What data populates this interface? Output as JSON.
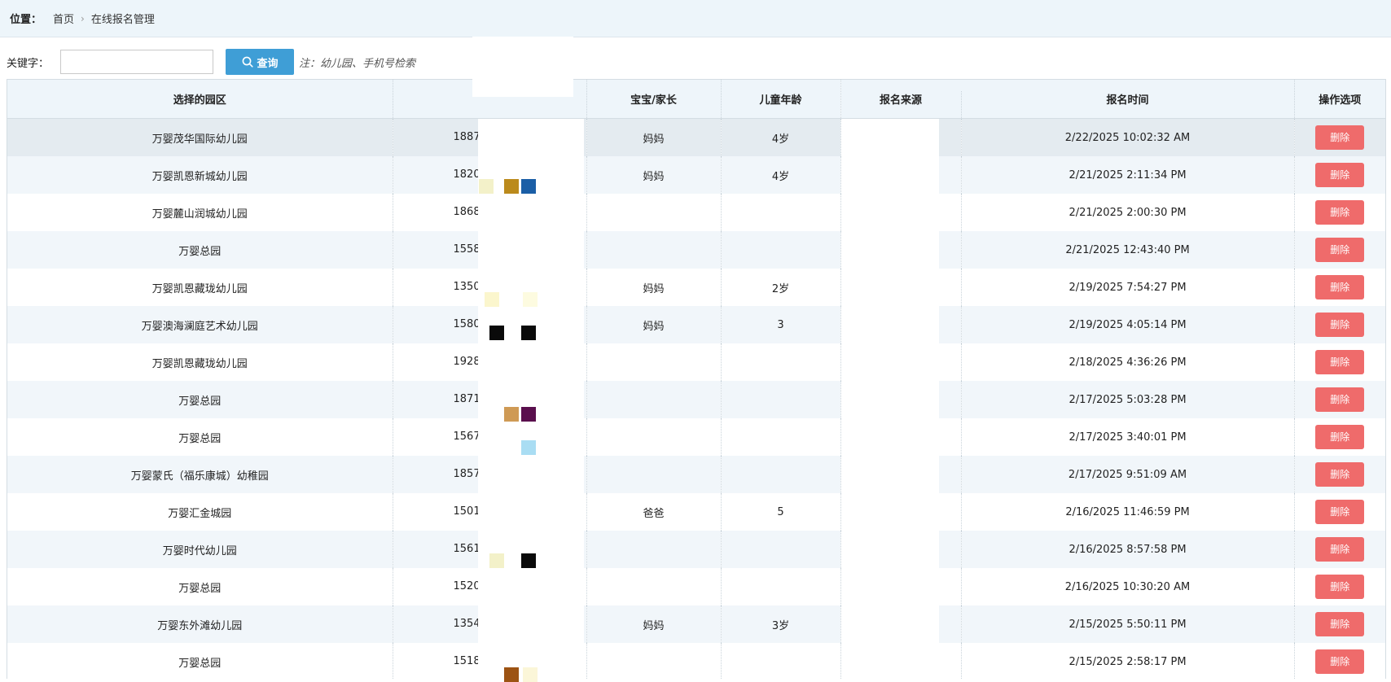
{
  "breadcrumb": {
    "label": "位置：",
    "items": [
      "首页",
      "在线报名管理"
    ],
    "separator": "›"
  },
  "search": {
    "keyword_label": "关键字：",
    "placeholder": "",
    "value": "",
    "button_label": "查询",
    "note": "注：幼儿园、手机号检索"
  },
  "table": {
    "headers": [
      "选择的园区",
      "",
      "宝宝/家长",
      "儿童年龄",
      "报名来源",
      "报名时间",
      "操作选项"
    ],
    "delete_label": "删除",
    "rows": [
      {
        "campus": "万婴茂华国际幼儿园",
        "phone": "1887",
        "role": "妈妈",
        "age": "4岁",
        "source": "",
        "time": "2/22/2025 10:02:32 AM"
      },
      {
        "campus": "万婴凯恩新城幼儿园",
        "phone": "1820",
        "role": "妈妈",
        "age": "4岁",
        "source": "",
        "time": "2/21/2025 2:11:34 PM"
      },
      {
        "campus": "万婴麓山润城幼儿园",
        "phone": "1868",
        "role": "",
        "age": "",
        "source": "",
        "time": "2/21/2025 2:00:30 PM"
      },
      {
        "campus": "万婴总园",
        "phone": "1558",
        "role": "",
        "age": "",
        "source": "",
        "time": "2/21/2025 12:43:40 PM"
      },
      {
        "campus": "万婴凯恩藏珑幼儿园",
        "phone": "1350",
        "role": "妈妈",
        "age": "2岁",
        "source": "",
        "time": "2/19/2025 7:54:27 PM"
      },
      {
        "campus": "万婴澳海澜庭艺术幼儿园",
        "phone": "1580",
        "role": "妈妈",
        "age": "3",
        "source": "",
        "time": "2/19/2025 4:05:14 PM"
      },
      {
        "campus": "万婴凯恩藏珑幼儿园",
        "phone": "1928",
        "role": "",
        "age": "",
        "source": "",
        "time": "2/18/2025 4:36:26 PM"
      },
      {
        "campus": "万婴总园",
        "phone": "1871",
        "role": "",
        "age": "",
        "source": "",
        "time": "2/17/2025 5:03:28 PM"
      },
      {
        "campus": "万婴总园",
        "phone": "1567",
        "role": "",
        "age": "",
        "source": "",
        "time": "2/17/2025 3:40:01 PM"
      },
      {
        "campus": "万婴蒙氏（福乐康城）幼稚园",
        "phone": "1857",
        "role": "",
        "age": "",
        "source": "",
        "time": "2/17/2025 9:51:09 AM"
      },
      {
        "campus": "万婴汇金城园",
        "phone": "1501",
        "role": "爸爸",
        "age": "5",
        "source": "",
        "time": "2/16/2025 11:46:59 PM"
      },
      {
        "campus": "万婴时代幼儿园",
        "phone": "1561",
        "role": "",
        "age": "",
        "source": "",
        "time": "2/16/2025 8:57:58 PM"
      },
      {
        "campus": "万婴总园",
        "phone": "1520",
        "role": "",
        "age": "",
        "source": "",
        "time": "2/16/2025 10:30:20 AM"
      },
      {
        "campus": "万婴东外滩幼儿园",
        "phone": "1354",
        "role": "妈妈",
        "age": "3岁",
        "source": "",
        "time": "2/15/2025 5:50:11 PM"
      },
      {
        "campus": "万婴总园",
        "phone": "1518",
        "role": "",
        "age": "",
        "source": "",
        "time": "2/15/2025 2:58:17 PM"
      }
    ]
  },
  "colors": {
    "topbar_bg": "#edf5fa",
    "query_button": "#3f9ed6",
    "delete_button": "#ef6b6b",
    "header_bg": "#eef5fa",
    "row_alt_bg": "#f1f6fa",
    "row_highlight_bg": "#e4ebf0"
  },
  "icons": {
    "query_button_icon": "search-icon",
    "breadcrumb_separator": "chevron-right-icon"
  }
}
